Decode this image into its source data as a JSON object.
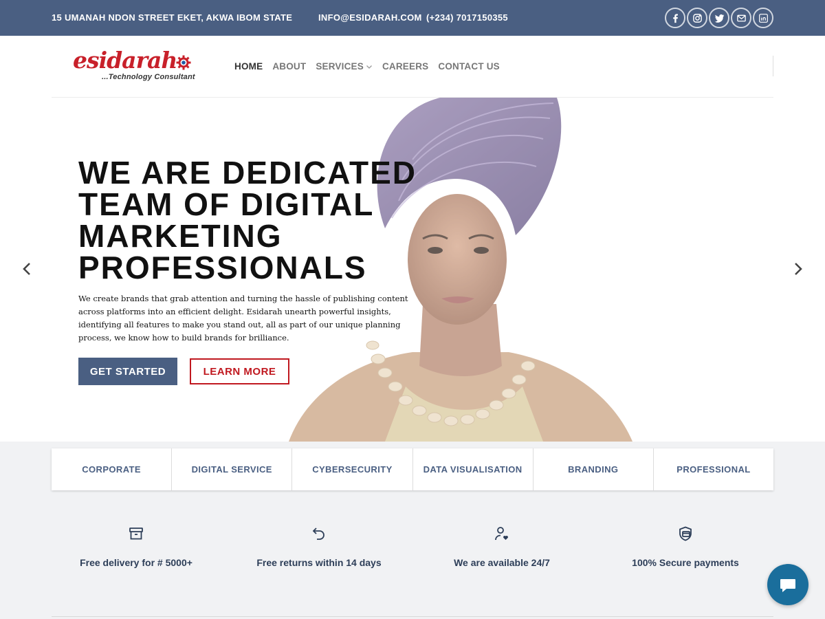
{
  "topbar": {
    "address": "15 UMANAH NDON STREET EKET, AKWA IBOM STATE",
    "email": "INFO@ESIDARAH.COM",
    "phone": "(+234) 7017150355",
    "social_icons": [
      "facebook-icon",
      "instagram-icon",
      "twitter-icon",
      "envelope-icon",
      "linkedin-icon"
    ]
  },
  "logo": {
    "word": "esidarah",
    "tagline": "...Technology Consultant"
  },
  "nav": {
    "items": [
      {
        "label": "HOME",
        "active": true
      },
      {
        "label": "ABOUT"
      },
      {
        "label": "SERVICES",
        "has_dropdown": true
      },
      {
        "label": "CAREERS"
      },
      {
        "label": "CONTACT US"
      }
    ]
  },
  "hero": {
    "title_lines": [
      "WE ARE DEDICATED",
      "TEAM OF DIGITAL",
      "MARKETING",
      "PROFESSIONALS"
    ],
    "description": "We create brands that grab attention and turning the hassle of publishing content across platforms into an efficient delight. Esidarah unearth powerful insights, identifying all features to make you stand out, all as part of our unique planning process, we know how to build brands for brilliance.",
    "primary_button": "GET STARTED",
    "secondary_button": "LEARN MORE"
  },
  "tabs": [
    "CORPORATE",
    "DIGITAL SERVICE",
    "CYBERSECURITY",
    "DATA VISUALISATION",
    "BRANDING",
    "PROFESSIONAL"
  ],
  "features": [
    {
      "icon": "archive-box-icon",
      "label": "Free delivery for # 5000+"
    },
    {
      "icon": "return-arrow-icon",
      "label": "Free returns within 14 days"
    },
    {
      "icon": "user-heart-icon",
      "label": "We are available 24/7"
    },
    {
      "icon": "secure-card-shield-icon",
      "label": "100% Secure payments"
    }
  ],
  "colors": {
    "brand_blue": "#4a5f82",
    "brand_red": "#c0181f",
    "chat_blue": "#1a6e9c",
    "lower_background": "#f1f2f4"
  }
}
